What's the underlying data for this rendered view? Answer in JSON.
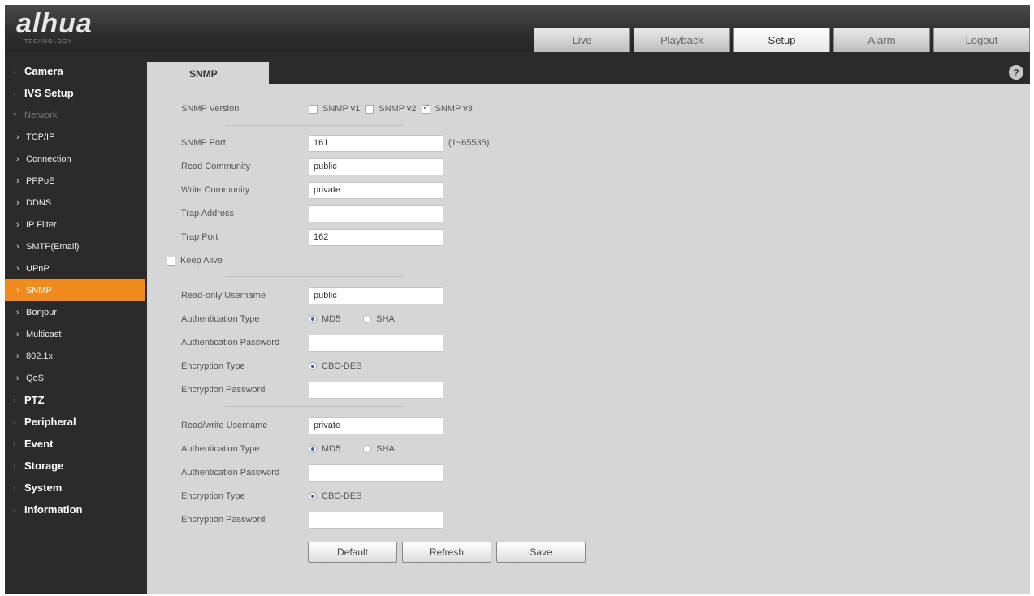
{
  "brand": {
    "logo": "alhua",
    "tagline": "TECHNOLOGY"
  },
  "topnav": [
    "Live",
    "Playback",
    "Setup",
    "Alarm",
    "Logout"
  ],
  "sidebar": {
    "camera": "Camera",
    "ivs": "IVS Setup",
    "network": "Network",
    "network_items": [
      "TCP/IP",
      "Connection",
      "PPPoE",
      "DDNS",
      "IP Filter",
      "SMTP(Email)",
      "UPnP",
      "SNMP",
      "Bonjour",
      "Multicast",
      "802.1x",
      "QoS"
    ],
    "ptz": "PTZ",
    "peripheral": "Peripheral",
    "event": "Event",
    "storage": "Storage",
    "system": "System",
    "information": "Information"
  },
  "tab": {
    "title": "SNMP",
    "help": "?"
  },
  "version": {
    "label": "SNMP Version",
    "v1": "SNMP v1",
    "v2": "SNMP v2",
    "v3": "SNMP v3"
  },
  "port": {
    "label": "SNMP Port",
    "value": "161",
    "hint": "(1~65535)"
  },
  "read_community": {
    "label": "Read Community",
    "value": "public"
  },
  "write_community": {
    "label": "Write Community",
    "value": "private"
  },
  "trap_address": {
    "label": "Trap Address",
    "value": ""
  },
  "trap_port": {
    "label": "Trap Port",
    "value": "162"
  },
  "keep_alive": {
    "label": "Keep Alive"
  },
  "readonly": {
    "username_label": "Read-only Username",
    "username": "public",
    "auth_type_label": "Authentication Type",
    "md5": "MD5",
    "sha": "SHA",
    "auth_pwd_label": "Authentication Password",
    "auth_pwd": "",
    "enc_type_label": "Encryption Type",
    "enc": "CBC-DES",
    "enc_pwd_label": "Encryption Password",
    "enc_pwd": ""
  },
  "readwrite": {
    "username_label": "Read/write Username",
    "username": "private",
    "auth_type_label": "Authentication Type",
    "md5": "MD5",
    "sha": "SHA",
    "auth_pwd_label": "Authentication Password",
    "auth_pwd": "",
    "enc_type_label": "Encryption Type",
    "enc": "CBC-DES",
    "enc_pwd_label": "Encryption Password",
    "enc_pwd": ""
  },
  "buttons": {
    "default": "Default",
    "refresh": "Refresh",
    "save": "Save"
  }
}
